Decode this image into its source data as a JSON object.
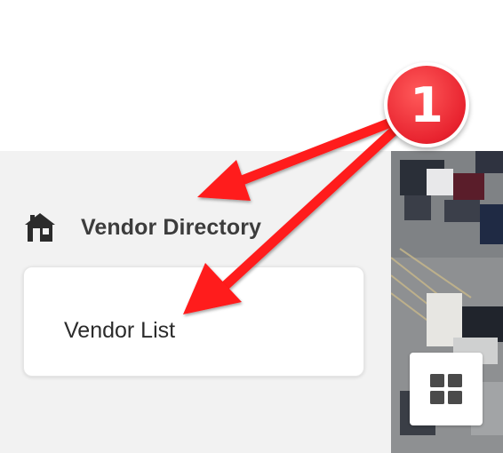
{
  "sidebar": {
    "section_title": "Vendor Directory",
    "section_icon": "home-icon",
    "items": [
      {
        "label": "Vendor List"
      }
    ]
  },
  "map": {
    "view_toggle_icon": "grid-icon"
  },
  "annotation": {
    "step_number": "1",
    "accent_color": "#e8232f"
  }
}
